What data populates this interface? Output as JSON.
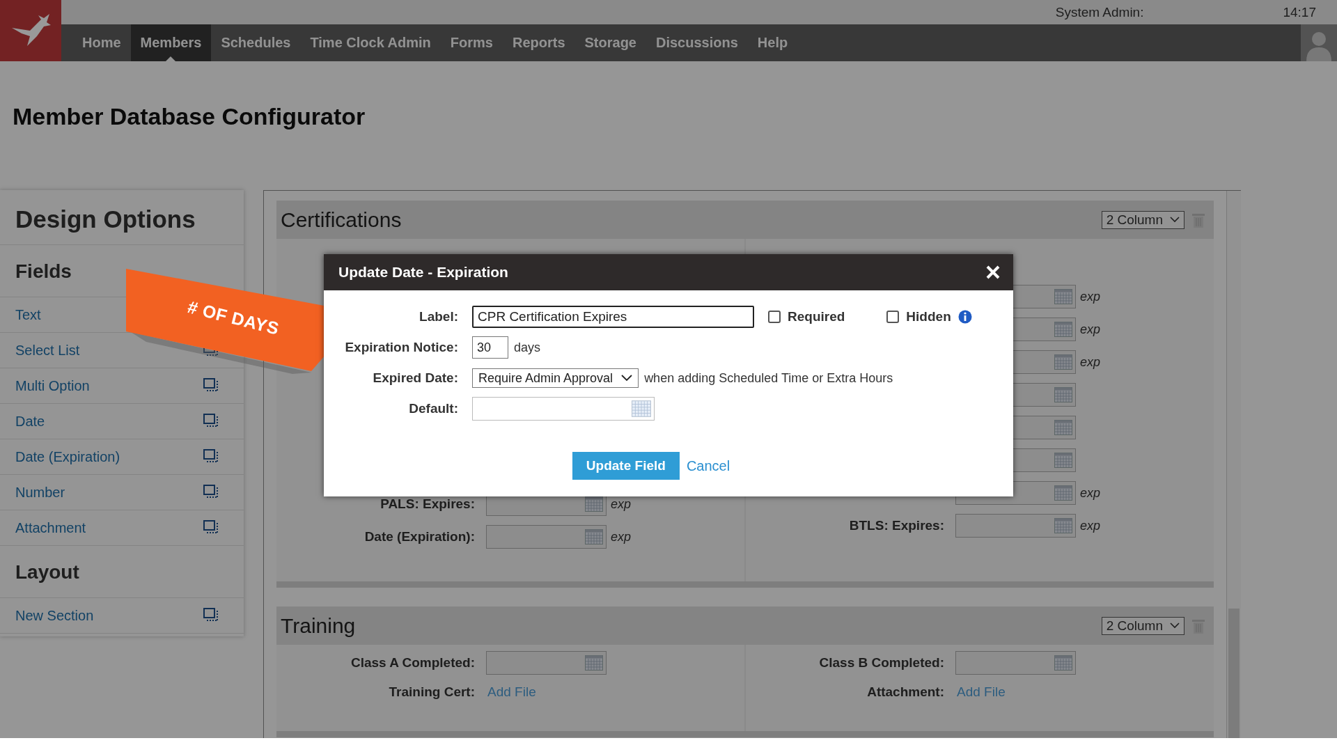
{
  "header": {
    "admin_label": "System Admin:",
    "time": "14:17"
  },
  "nav": [
    {
      "label": "Home",
      "selected": false
    },
    {
      "label": "Members",
      "selected": true
    },
    {
      "label": "Schedules",
      "selected": false
    },
    {
      "label": "Time Clock Admin",
      "selected": false
    },
    {
      "label": "Forms",
      "selected": false
    },
    {
      "label": "Reports",
      "selected": false
    },
    {
      "label": "Storage",
      "selected": false
    },
    {
      "label": "Discussions",
      "selected": false
    },
    {
      "label": "Help",
      "selected": false
    }
  ],
  "page_title": "Member Database Configurator",
  "design_options": {
    "title": "Design Options",
    "groups": [
      {
        "title": "Fields",
        "items": [
          "Text",
          "Select List",
          "Multi Option",
          "Date",
          "Date (Expiration)",
          "Number",
          "Attachment"
        ]
      },
      {
        "title": "Layout",
        "items": [
          "New Section"
        ]
      }
    ]
  },
  "sections": [
    {
      "title": "Certifications",
      "columns_select": "2 Column",
      "left": [
        {
          "label": "PALS: Expires:",
          "kind": "date",
          "note": "exp"
        },
        {
          "label": "Date (Expiration):",
          "kind": "date",
          "note": "exp"
        }
      ],
      "right": [
        {
          "kind": "date",
          "note": "exp"
        },
        {
          "kind": "date",
          "note": "exp"
        },
        {
          "kind": "date",
          "note": "exp"
        },
        {
          "kind": "date"
        },
        {
          "kind": "date"
        },
        {
          "kind": "date"
        },
        {
          "kind": "date",
          "note": "exp"
        },
        {
          "label": "BTLS: Expires:",
          "kind": "date",
          "note": "exp"
        }
      ]
    },
    {
      "title": "Training",
      "columns_select": "2 Column",
      "left": [
        {
          "label": "Class A Completed:",
          "kind": "date"
        },
        {
          "label": "Training Cert:",
          "kind": "file",
          "link": "Add File"
        }
      ],
      "right": [
        {
          "label": "Class B Completed:",
          "kind": "date"
        },
        {
          "label": "Attachment:",
          "kind": "file",
          "link": "Add File"
        }
      ]
    }
  ],
  "callout": {
    "text": "# OF DAYS"
  },
  "dialog": {
    "title": "Update Date - Expiration",
    "label_field": {
      "label": "Label:",
      "value": "CPR Certification Expires"
    },
    "checkboxes": [
      {
        "label": "Required",
        "checked": false,
        "info": false
      },
      {
        "label": "Hidden",
        "checked": false,
        "info": true
      }
    ],
    "notice": {
      "label": "Expiration Notice:",
      "value": "30",
      "unit": "days"
    },
    "expired": {
      "label": "Expired Date:",
      "value": "Require Admin Approval",
      "suffix": "when adding Scheduled Time or Extra Hours"
    },
    "default": {
      "label": "Default:"
    },
    "submit": "Update Field",
    "cancel": "Cancel"
  }
}
